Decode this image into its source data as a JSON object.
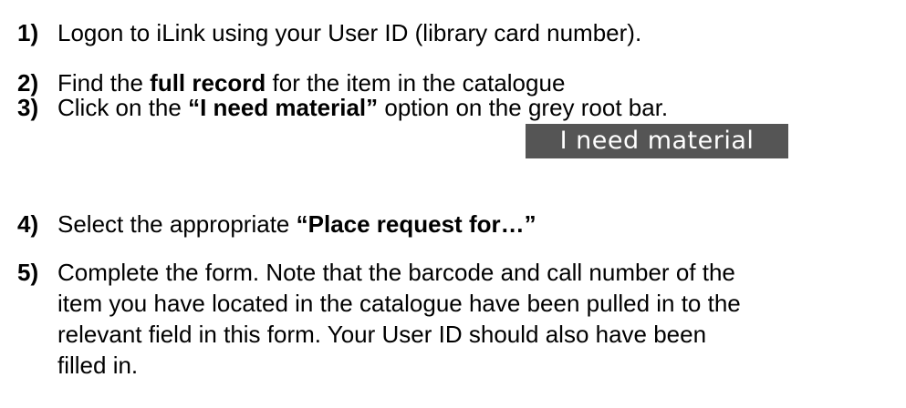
{
  "steps": [
    {
      "num": "1)",
      "text": "Logon to iLink using your User ID (library card number)."
    },
    {
      "num": "2)",
      "pre": "Find the ",
      "bold": "full record",
      "post": " for the item in the catalogue"
    },
    {
      "num": "3)",
      "pre": "Click on the ",
      "bold": "“I need material”",
      "post": " option on the grey root bar."
    },
    {
      "num": "4)",
      "pre": "Select the appropriate ",
      "bold": "“Place request for…”"
    },
    {
      "num": "5)",
      "lines": [
        "Complete the form.  Note that the barcode and call number of the",
        "item you have located in the catalogue have been pulled in to the",
        "relevant field in this form.  Your User ID should also have been",
        "filled in."
      ]
    }
  ],
  "root_bar": {
    "label": "I need material"
  }
}
